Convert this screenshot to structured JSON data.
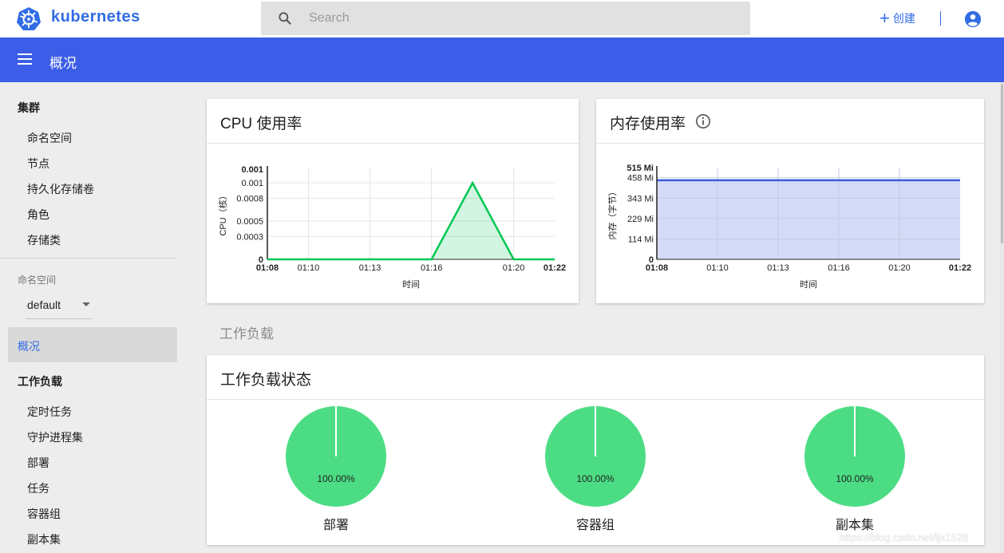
{
  "app": {
    "brand": "kubernetes"
  },
  "search": {
    "placeholder": "Search"
  },
  "toolbar": {
    "create_label": "创建"
  },
  "header": {
    "title": "概况"
  },
  "sidebar": {
    "cluster_title": "集群",
    "cluster_items": [
      "命名空间",
      "节点",
      "持久化存储卷",
      "角色",
      "存储类"
    ],
    "namespace_label": "命名空间",
    "namespace_value": "default",
    "overview_label": "概况",
    "workloads_title": "工作负载",
    "workload_items": [
      "定时任务",
      "守护进程集",
      "部署",
      "任务",
      "容器组",
      "副本集"
    ]
  },
  "cpu_card": {
    "title": "CPU 使用率"
  },
  "memory_card": {
    "title": "内存使用率"
  },
  "workloads_section": {
    "label": "工作负载"
  },
  "workload_status_card": {
    "title": "工作负载状态"
  },
  "colors": {
    "accent": "#326ce5",
    "header": "#3b5de7",
    "cpu_line": "#00c853",
    "memory_line": "#3a5bd9",
    "pie_green": "#4cdd84"
  },
  "watermark": "https://blog.csdn.net/ljx1528",
  "chart_data": [
    {
      "type": "line",
      "title": "CPU 使用率",
      "xlabel": "时间",
      "ylabel": "CPU（核）",
      "x": [
        "01:08",
        "01:10",
        "01:13",
        "01:16",
        "01:18",
        "01:20",
        "01:22"
      ],
      "x_ticks": [
        "01:08",
        "01:10",
        "01:13",
        "01:16",
        "01:20",
        "01:22"
      ],
      "y_ticks": [
        "0",
        "0.0003",
        "0.0005",
        "0.0008",
        "0.001",
        "0.001"
      ],
      "ylim": [
        0,
        0.0012
      ],
      "series": [
        {
          "values": [
            0,
            0,
            0,
            0,
            0.001,
            0,
            0
          ]
        }
      ],
      "grid": true
    },
    {
      "type": "area",
      "title": "内存使用率",
      "xlabel": "时间",
      "ylabel": "内存（字节）",
      "x": [
        "01:08",
        "01:10",
        "01:13",
        "01:16",
        "01:20",
        "01:22"
      ],
      "y_ticks": [
        "0",
        "114 Mi",
        "229 Mi",
        "343 Mi",
        "458 Mi",
        "515 Mi"
      ],
      "ylim": [
        0,
        515
      ],
      "series": [
        {
          "values": [
            444,
            444,
            444,
            444,
            444,
            444
          ]
        }
      ],
      "grid": true
    },
    {
      "type": "pie",
      "charts": [
        {
          "label": "部署",
          "value_label": "100.00%",
          "value": 100
        },
        {
          "label": "容器组",
          "value_label": "100.00%",
          "value": 100
        },
        {
          "label": "副本集",
          "value_label": "100.00%",
          "value": 100
        }
      ]
    }
  ]
}
